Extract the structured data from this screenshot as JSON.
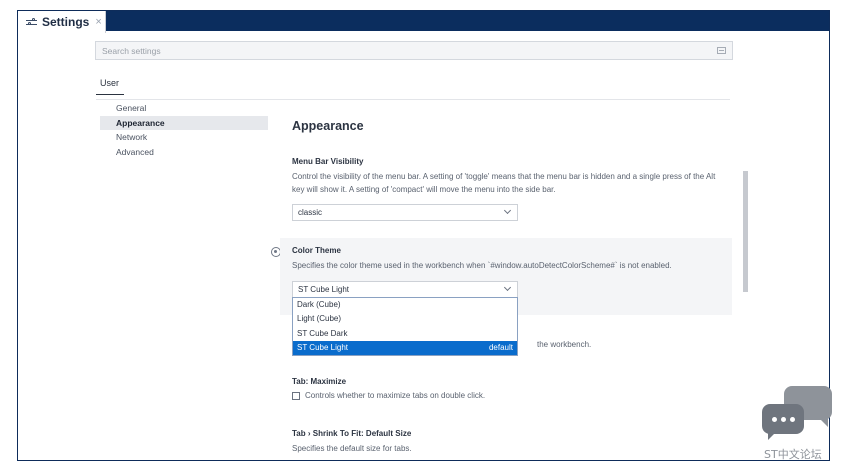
{
  "tab": {
    "label": "Settings",
    "close": "×",
    "icon": "settings-sliders-icon"
  },
  "search": {
    "placeholder": "Search settings",
    "value": ""
  },
  "scope": {
    "user_tab": "User"
  },
  "toc": {
    "items": [
      {
        "label": "General",
        "active": false
      },
      {
        "label": "Appearance",
        "active": true
      },
      {
        "label": "Network",
        "active": false
      },
      {
        "label": "Advanced",
        "active": false
      }
    ]
  },
  "main": {
    "section_title": "Appearance",
    "menu_bar": {
      "title": "Menu Bar Visibility",
      "desc": "Control the visibility of the menu bar. A setting of 'toggle' means that the menu bar is hidden and a single press of the Alt key will show it. A setting of 'compact' will move the menu into the side bar.",
      "value": "classic"
    },
    "color_theme": {
      "title": "Color Theme",
      "desc": "Specifies the color theme used in the workbench when `#window.autoDetectColorScheme#` is not enabled.",
      "value": "ST Cube Light",
      "options": [
        "Dark (Cube)",
        "Light (Cube)",
        "ST Cube Dark",
        "ST Cube Light"
      ],
      "selected_badge": "default",
      "hidden_desc_tail": "the workbench."
    },
    "tab_maximize": {
      "title": "Tab: Maximize",
      "checkbox_label": "Controls whether to maximize tabs on double click."
    },
    "tab_shrink": {
      "title": "Tab › Shrink To Fit: Default Size",
      "desc": "Specifies the default size for tabs."
    }
  },
  "watermark": {
    "text": "ST中文论坛"
  },
  "colors": {
    "tabbar": "#0b2d5e",
    "selection": "#0a6ccc"
  }
}
